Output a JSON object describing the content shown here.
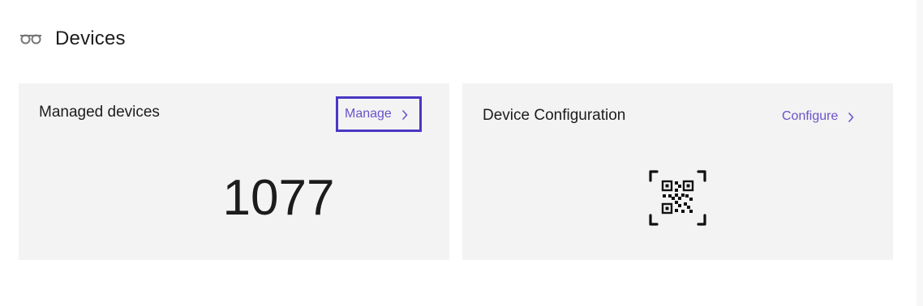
{
  "section": {
    "icon": "glasses-icon",
    "title": "Devices"
  },
  "managed_card": {
    "title": "Managed devices",
    "link_label": "Manage",
    "link_icon": "chevron-right-icon",
    "count": "1077"
  },
  "config_card": {
    "title": "Device Configuration",
    "link_label": "Configure",
    "link_icon": "chevron-right-icon",
    "icon": "qr-code-icon"
  },
  "colors": {
    "accent": "#6b52c9",
    "focus_outline": "#4a37c4",
    "card_background": "#f3f3f3",
    "text": "#1c1c1c"
  }
}
